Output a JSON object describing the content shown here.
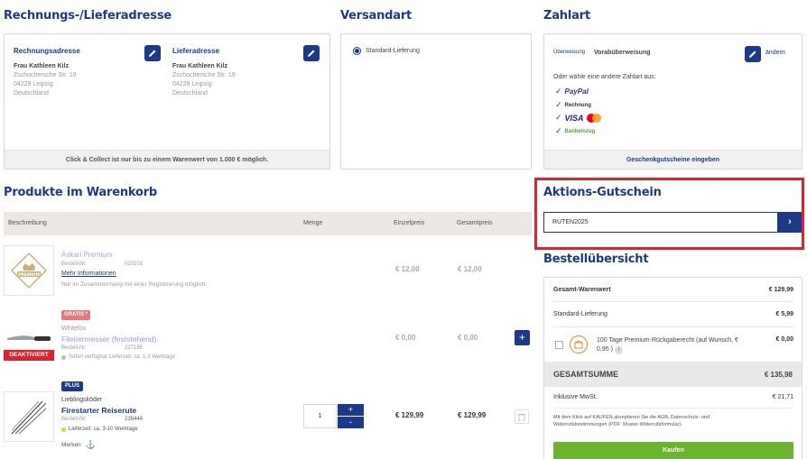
{
  "address": {
    "heading": "Rechnungs-/Lieferadresse",
    "billing": {
      "label": "Rechnungsadresse",
      "name": "Frau Kathleen Kilz",
      "street": "Zschochersche Str. 19",
      "city": "04229 Leipzig",
      "country": "Deutschland"
    },
    "shipping": {
      "label": "Lieferadresse",
      "name": "Frau Kathleen Kilz",
      "street": "Zschochersche Str. 19",
      "city": "04229 Leipzig",
      "country": "Deutschland"
    },
    "footer_note": "Click & Collect ist nur bis zu einem Warenwert von 1.000 € möglich."
  },
  "shipping_method": {
    "heading": "Versandart",
    "option": "Standard-Lieferung"
  },
  "payment": {
    "heading": "Zahlart",
    "selected_logo_text": "Überweisung",
    "selected_label": "Vorabüberweisung",
    "change_label": "ändern",
    "other_prompt": "Oder wähle eine andere Zahlart aus:",
    "methods": [
      "PayPal",
      "Rechnung",
      "VISA",
      "Bankeinzug"
    ],
    "voucher_link": "Geschenkgutscheine eingeben"
  },
  "cart": {
    "heading": "Produkte im Warenkorb",
    "columns": {
      "description": "Beschreibung",
      "quantity": "Menge",
      "unit_price": "Einzelpreis",
      "total_price": "Gesamtpreis"
    },
    "items": [
      {
        "brand": "Askari Premium",
        "order_no_label": "Bestell-Nr.",
        "order_no": "010101",
        "more_info": "Mehr Informationen",
        "note": "Nur im Zusammenhang mit einer Registrierung möglich.",
        "unit_price": "€ 12,00",
        "total_price": "€ 12,00",
        "badge_text": "PREMIUM"
      },
      {
        "badge": "GRATIS *",
        "brand": "Whitefox",
        "name": "Filetiermesser (feststehend)",
        "order_no_label": "Bestell-Nr.",
        "order_no": "227185",
        "availability": "Sofort verfügbar Lieferzeit: ca. 1-3 Werktage",
        "unit_price": "€ 0,00",
        "total_price": "€ 0,00",
        "status_overlay": "DEAKTIVIERT"
      },
      {
        "badge": "PLUS",
        "brand": "Lieblingsköder",
        "name": "Firestarter Reiserute",
        "order_no_label": "Bestell-Nr.",
        "order_no": "235444",
        "availability": "Lieferzeit: ca. 3-10 Werktage",
        "bookmark_label": "Merken",
        "quantity": "1",
        "unit_price": "€ 129,99",
        "total_price": "€ 129,99"
      }
    ]
  },
  "coupon": {
    "heading": "Aktions-Gutschein",
    "value": "RUTEN2025"
  },
  "summary": {
    "heading": "Bestellübersicht",
    "goods_label": "Gesamt-Warenwert",
    "goods_value": "€ 129,99",
    "shipping_label": "Standard-Lieferung",
    "shipping_value": "€ 5,99",
    "return_label": "100 Tage Premium-Rückgaberecht (auf Wunsch, € 0,95 )",
    "return_value": "€ 0,00",
    "total_label": "GESAMTSUMME",
    "total_value": "€ 135,98",
    "vat_label": "Inklusive MwSt.",
    "vat_value": "€ 21,71",
    "legal_text": "Mit dem Klick auf KAUFEN akzeptieren Sie die AGB, Datenschutz- und Widerrufsbestimmungen (PDF: Muster-Widerrufsformular).",
    "buy_label": "Kaufen"
  },
  "colors": {
    "brand": "#1d3a8a",
    "accent_red": "#d9232e",
    "buy_green": "#6bb52e",
    "table_head": "#ede8e4"
  }
}
